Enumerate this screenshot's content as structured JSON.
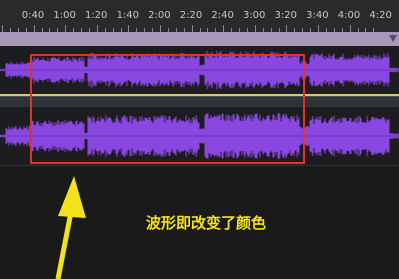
{
  "timeline": {
    "labels": [
      "0:40",
      "1:00",
      "1:20",
      "1:40",
      "2:00",
      "2:20",
      "2:40",
      "3:00",
      "3:20",
      "3:40",
      "4:00",
      "4:20"
    ]
  },
  "annotation": {
    "text": "波形即改变了颜色"
  },
  "colors": {
    "waveform": "#8a46e0",
    "highlight_box": "#e0332f",
    "annotation_text": "#f2e21a",
    "arrow": "#f2e21a"
  }
}
